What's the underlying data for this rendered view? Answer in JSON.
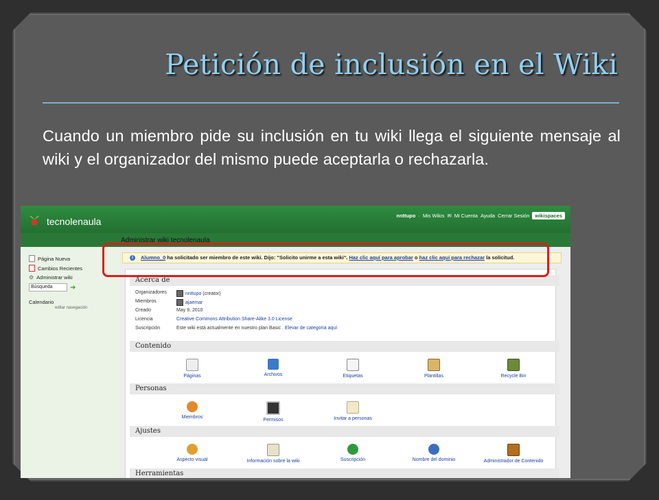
{
  "slide": {
    "title": "Petición de inclusión en el Wiki",
    "body": "Cuando un miembro pide su inclusión en tu wiki llega el siguiente mensaje al wiki y el organizador del mismo puede aceptarla o rechazarla."
  },
  "screenshot": {
    "site_name": "tecnolenaula",
    "page_heading": "Administrar wiki tecnolenaula",
    "user_nav": {
      "username": "nnttupo",
      "my_wikis": "Mis Wikis",
      "my_account": "Mi Cuenta",
      "help": "Ayuda",
      "logout": "Cerrar Sesión",
      "brand": "wikispaces"
    },
    "sidebar": {
      "items": [
        "Página Nueva",
        "Cambios Recientes",
        "Administrar wiki"
      ],
      "search_value": "Búsqueda",
      "calendar": "Calendario",
      "edit_nav": "editar navegación"
    },
    "notice": {
      "user_link": "Alumno_0",
      "text1": " ha solicitado ser miembro de este wiki. Dijo: \"Solicito unirme a esta wiki\". ",
      "approve_link": "Haz clic aquí para aprobar",
      "text2": " o ",
      "reject_link": "haz clic aquí para rechazar",
      "text3": " la solicitud."
    },
    "about": {
      "heading": "Acerca de",
      "rows": [
        {
          "label": "Organizadores",
          "value": "nnttupo",
          "suffix": " (creator)"
        },
        {
          "label": "Miembros",
          "value": "ajaemar",
          "suffix": ""
        },
        {
          "label": "Creado",
          "value": "May 9, 2010",
          "suffix": ""
        },
        {
          "label": "Licencia",
          "value": "Creative Commons Attribution Share-Alike 3.0 License",
          "suffix": ""
        },
        {
          "label": "Suscripción",
          "value": "Este wiki está actualmente en nuestro plan Basic",
          "suffix": " . Elevar de categoría aquí"
        }
      ]
    },
    "contenido": {
      "heading": "Contenido",
      "tiles": [
        "Páginas",
        "Archivos",
        "Etiquetas",
        "Plantillas",
        "Recycle Bin"
      ]
    },
    "personas": {
      "heading": "Personas",
      "tiles": [
        "Miembros",
        "Permisos",
        "Invitar a personas"
      ]
    },
    "ajustes": {
      "heading": "Ajustes",
      "tiles": [
        "Aspecto visual",
        "Información sobre la wiki",
        "Suscripción",
        "Nombre del dominio",
        "Administrador de Contenido"
      ]
    },
    "herramientas": {
      "heading": "Herramientas"
    }
  },
  "colors": {
    "title": "#8fd0f2",
    "highlight": "#e01a1a",
    "wiki_green": "#2e7d3c",
    "link": "#1a3f9e"
  }
}
